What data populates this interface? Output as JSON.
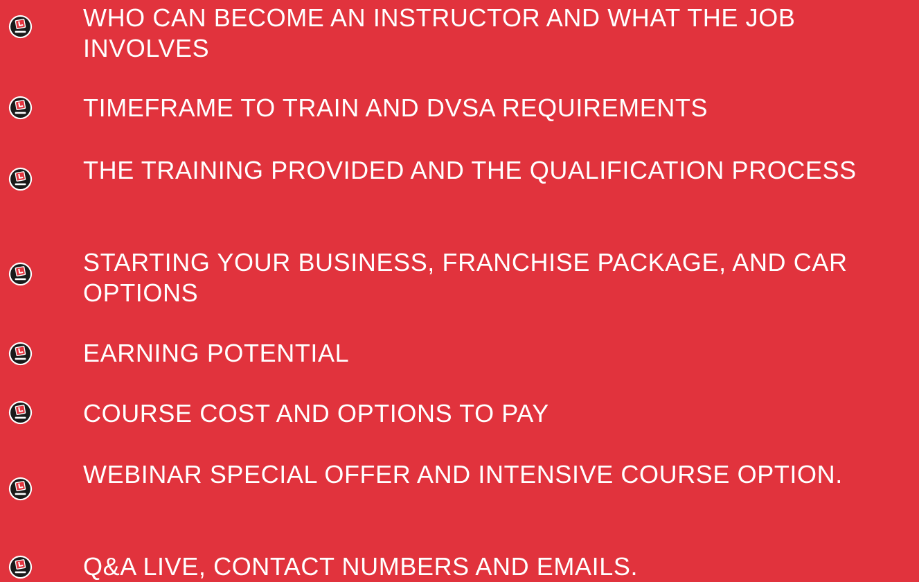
{
  "bullet_icon": "l-drive-logo-icon",
  "colors": {
    "background": "#e1333d",
    "text": "#ffffff",
    "bullet_circle": "#1a1a1a",
    "bullet_accent": "#e1333d"
  },
  "agenda": {
    "items": [
      {
        "text": "WHO CAN BECOME AN INSTRUCTOR AND WHAT THE JOB INVOLVES"
      },
      {
        "text": "TIMEFRAME TO TRAIN AND DVSA REQUIREMENTS"
      },
      {
        "text": "THE TRAINING PROVIDED AND THE QUALIFICATION PROCESS"
      },
      {
        "text": "STARTING YOUR BUSINESS, FRANCHISE PACKAGE, AND CAR OPTIONS"
      },
      {
        "text": "EARNING POTENTIAL"
      },
      {
        "text": "COURSE COST AND OPTIONS TO PAY"
      },
      {
        "text": "WEBINAR SPECIAL OFFER AND INTENSIVE COURSE OPTION."
      },
      {
        "text": "Q&A LIVE, CONTACT NUMBERS AND EMAILS."
      }
    ]
  }
}
